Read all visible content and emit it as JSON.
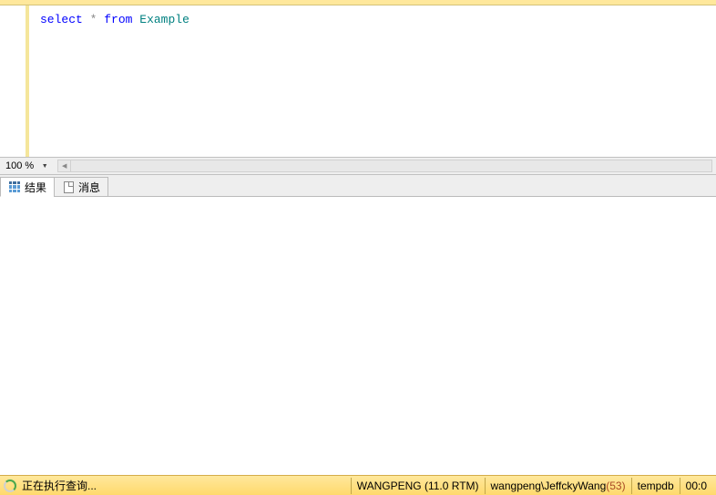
{
  "editor": {
    "sql": {
      "kw1": "select",
      "wild": "*",
      "kw2": "from",
      "table": "Example"
    }
  },
  "zoom": {
    "level": "100 %"
  },
  "tabs": {
    "results": "结果",
    "messages": "消息"
  },
  "status": {
    "executing": "正在执行查询...",
    "server": "WANGPENG (11.0 RTM)",
    "user_prefix": "wangpeng\\JeffckyWang ",
    "session_id": "(53)",
    "database": "tempdb",
    "elapsed": "00:0"
  }
}
